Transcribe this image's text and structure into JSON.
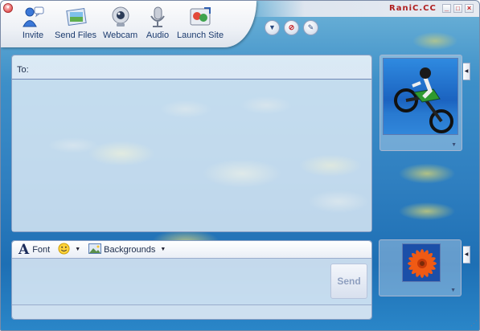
{
  "window": {
    "brand": "RaniC.CC",
    "controls": [
      "_",
      "□",
      "×"
    ]
  },
  "toolbar": {
    "buttons": [
      {
        "label": "Invite",
        "icon": "invite-person-icon"
      },
      {
        "label": "Send Files",
        "icon": "send-files-icon"
      },
      {
        "label": "Webcam",
        "icon": "webcam-icon"
      },
      {
        "label": "Audio",
        "icon": "microphone-icon"
      },
      {
        "label": "Launch Site",
        "icon": "launch-site-icon"
      }
    ],
    "extra_buttons": [
      "dropdown-arrow-icon",
      "block-icon",
      "paint-brush-icon"
    ]
  },
  "conversation": {
    "to_label": "To:",
    "history_text": ""
  },
  "compose": {
    "font_label": "Font",
    "emoticon_icon": "smiley-icon",
    "backgrounds_label": "Backgrounds",
    "input_value": "",
    "send_label": "Send"
  },
  "display_pictures": {
    "contact": "motocross-rider-picture",
    "self": "orange-flower-picture"
  },
  "colors": {
    "accent": "#1c3b6e",
    "brand": "#b01e1e",
    "panel_border": "#8aa0c4"
  }
}
